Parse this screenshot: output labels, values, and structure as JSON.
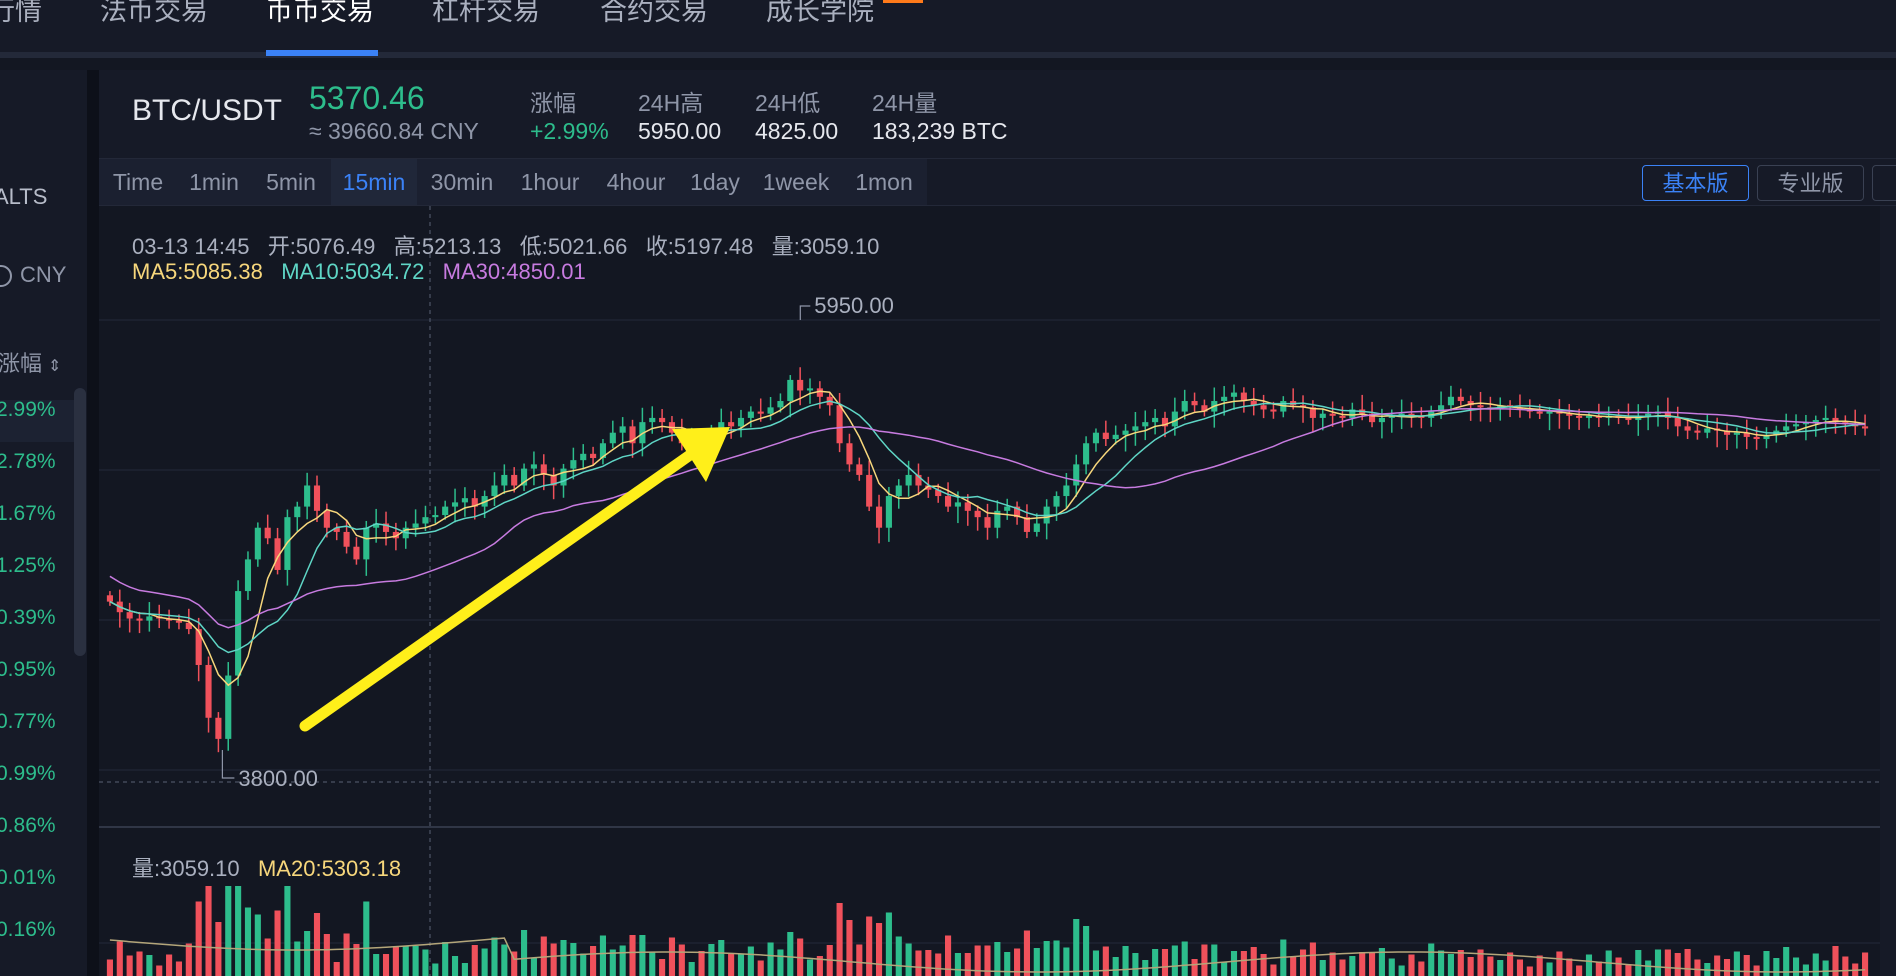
{
  "nav": {
    "items": [
      {
        "label": "行情"
      },
      {
        "label": "法币交易"
      },
      {
        "label": "币币交易"
      },
      {
        "label": "杠杆交易"
      },
      {
        "label": "合约交易"
      },
      {
        "label": "成长学院"
      }
    ],
    "active_index": 2
  },
  "left_panel": {
    "alts_label": "ALTS",
    "currency_label": "CNY",
    "change_header": "涨幅",
    "pcts": [
      "2.99%",
      "2.78%",
      "1.67%",
      "1.25%",
      "0.39%",
      "0.95%",
      "0.77%",
      "0.99%",
      "0.86%",
      "0.01%",
      "0.16%"
    ]
  },
  "ticker": {
    "pair": "BTC/USDT",
    "price": "5370.46",
    "cny_price": "≈ 39660.84 CNY",
    "change_label": "涨幅",
    "change_value": "+2.99%",
    "high_label": "24H高",
    "high_value": "5950.00",
    "low_label": "24H低",
    "low_value": "4825.00",
    "volume_label": "24H量",
    "volume_value": "183,239 BTC"
  },
  "intervals": [
    "Time",
    "1min",
    "5min",
    "15min",
    "30min",
    "1hour",
    "4hour",
    "1day",
    "1week",
    "1mon"
  ],
  "active_interval": "15min",
  "version_buttons": {
    "basic": "基本版",
    "pro": "专业版"
  },
  "ohlc_legend": {
    "time": "03-13 14:45",
    "open": "开:5076.49",
    "high": "高:5213.13",
    "low": "低:5021.66",
    "close": "收:5197.48",
    "volume": "量:3059.10"
  },
  "ma_legend": {
    "ma5": "MA5:5085.38",
    "ma10": "MA10:5034.72",
    "ma30": "MA30:4850.01"
  },
  "volume_legend": {
    "volume": "量:3059.10",
    "ma20": "MA20:5303.18"
  },
  "colors": {
    "up": "#2dbd8c",
    "down": "#f0515b",
    "ma5": "#f7d77c",
    "ma10": "#5fd6c6",
    "ma30": "#c77be0",
    "accent": "#3b82f6",
    "arrow": "#ffef1a"
  },
  "chart_data": {
    "type": "candlestick",
    "interval": "15min",
    "high_marker": "5950.00",
    "low_marker": "3800.00",
    "close": [
      4550,
      4500,
      4470,
      4460,
      4480,
      4470,
      4460,
      4450,
      4420,
      4250,
      4000,
      3900,
      4200,
      4600,
      4750,
      4900,
      4850,
      4700,
      4950,
      5000,
      5100,
      4980,
      4900,
      4880,
      4810,
      4750,
      4900,
      4920,
      4880,
      4850,
      4900,
      4920,
      4950,
      4960,
      5000,
      5020,
      5040,
      5000,
      5050,
      5100,
      5150,
      5100,
      5180,
      5200,
      5150,
      5100,
      5180,
      5220,
      5250,
      5230,
      5300,
      5350,
      5380,
      5300,
      5400,
      5420,
      5400,
      5350,
      5300,
      5320,
      5300,
      5360,
      5400,
      5380,
      5420,
      5450,
      5440,
      5470,
      5500,
      5600,
      5550,
      5560,
      5520,
      5480,
      5300,
      5200,
      5150,
      5000,
      4900,
      5050,
      5100,
      5150,
      5100,
      5080,
      5050,
      5000,
      5020,
      4980,
      4950,
      4900,
      4980,
      5000,
      4950,
      4880,
      4920,
      5000,
      5050,
      5100,
      5200,
      5300,
      5350,
      5320,
      5340,
      5360,
      5380,
      5400,
      5420,
      5380,
      5450,
      5500,
      5480,
      5450,
      5500,
      5520,
      5540,
      5500,
      5480,
      5460,
      5450,
      5500,
      5480,
      5470,
      5420,
      5440,
      5430,
      5420,
      5460,
      5440,
      5400,
      5420,
      5430,
      5440,
      5430,
      5420,
      5450,
      5480,
      5520,
      5500,
      5480,
      5470,
      5460,
      5480,
      5470,
      5460,
      5450,
      5440,
      5450,
      5440,
      5430,
      5420,
      5430,
      5420,
      5430,
      5420,
      5410,
      5430,
      5440,
      5450,
      5420,
      5380,
      5360,
      5350,
      5370,
      5360,
      5340,
      5350,
      5330,
      5320,
      5340,
      5360,
      5380,
      5390,
      5400,
      5410,
      5420,
      5400,
      5390,
      5380,
      5370
    ],
    "ma5_last": 5085.38,
    "ma10_last": 5034.72,
    "ma30_last": 4850.01,
    "volume_ma20_last": 5303.18
  }
}
